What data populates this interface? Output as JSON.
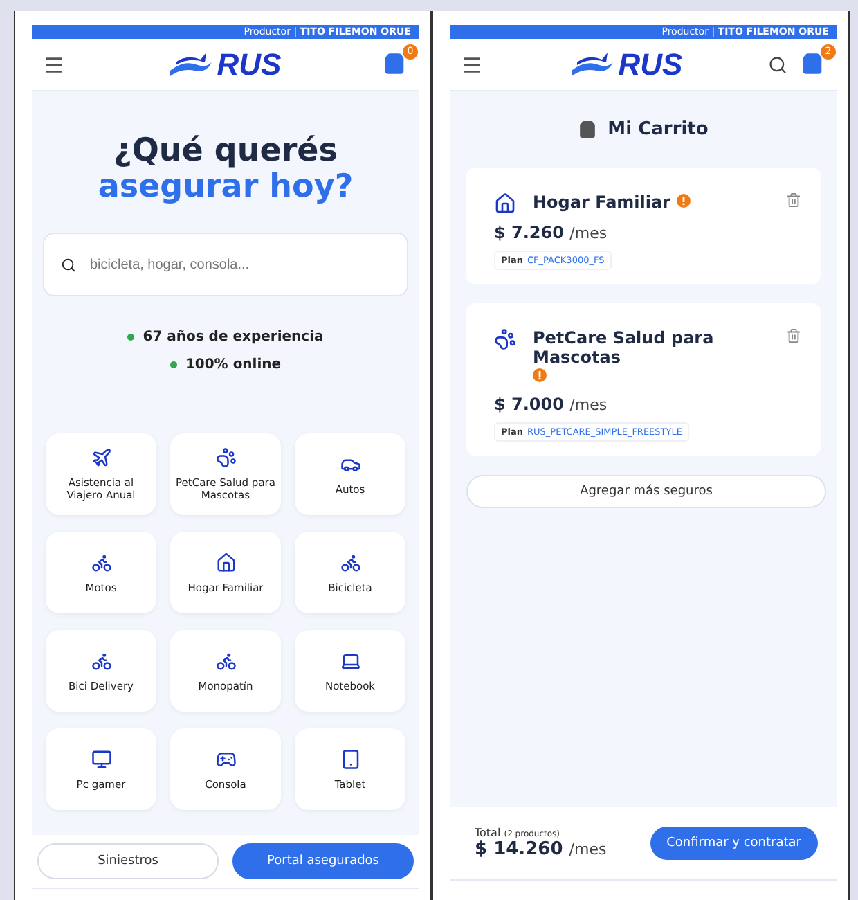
{
  "left": {
    "producer_label": "Productor",
    "separator": "|",
    "producer_name": "TITO FILEMON ORUE",
    "logo": "RUS",
    "cart_count": "0",
    "heading_line1": "¿Qué querés",
    "heading_line2": "asegurar hoy?",
    "search": {
      "placeholder": "bicicleta, hogar, consola..."
    },
    "highlights": [
      "67 años de experiencia",
      "100% online"
    ],
    "products": [
      {
        "label": "Asistencia al Viajero Anual"
      },
      {
        "label": "PetCare Salud para Mascotas"
      },
      {
        "label": "Autos"
      },
      {
        "label": "Motos"
      },
      {
        "label": "Hogar Familiar"
      },
      {
        "label": "Bicicleta"
      },
      {
        "label": "Bici Delivery"
      },
      {
        "label": "Monopatín"
      },
      {
        "label": "Notebook"
      },
      {
        "label": "Pc gamer"
      },
      {
        "label": "Consola"
      },
      {
        "label": "Tablet"
      }
    ],
    "buttons": [
      {
        "label": "Siniestros",
        "primary": false
      },
      {
        "label": "Portal asegurados",
        "primary": true
      }
    ]
  },
  "right": {
    "producer_label": "Productor",
    "separator": "|",
    "producer_name": "TITO FILEMON ORUE",
    "logo": "RUS",
    "cart_count": "2",
    "title": "Mi Carrito",
    "items": [
      {
        "name": "Hogar Familiar",
        "price": "$ 7.260",
        "period": "/mes",
        "plan_label": "Plan",
        "plan": "CF_PACK3000_FS"
      },
      {
        "name": "PetCare Salud para Mascotas",
        "price": "$ 7.000",
        "period": "/mes",
        "plan_label": "Plan",
        "plan": "RUS_PETCARE_SIMPLE_FREESTYLE"
      }
    ],
    "add_button": "Agregar más seguros",
    "total_label": "Total",
    "total_count": "(2 productos)",
    "total_price": "$ 14.260",
    "total_period": "/mes",
    "confirm_button": "Confirmar y contratar"
  }
}
